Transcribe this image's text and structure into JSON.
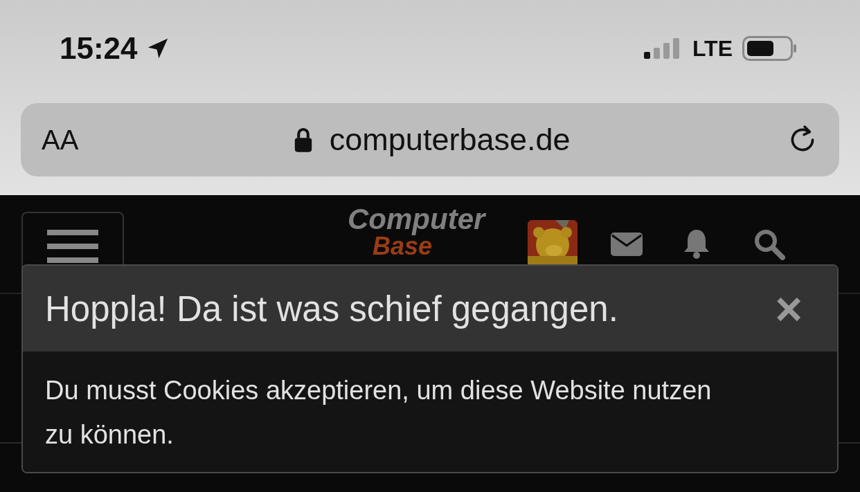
{
  "status_bar": {
    "time": "15:24",
    "network": "LTE"
  },
  "address_bar": {
    "text_size_button": "AA",
    "url": "computerbase.de"
  },
  "site_header": {
    "logo": {
      "first_line": "Computer",
      "second_line": "Base"
    }
  },
  "dialog": {
    "title": "Hoppla! Da ist was schief gegangen.",
    "close": "×",
    "message": "Du musst Cookies akzeptieren, um diese Website nutzen zu können."
  }
}
